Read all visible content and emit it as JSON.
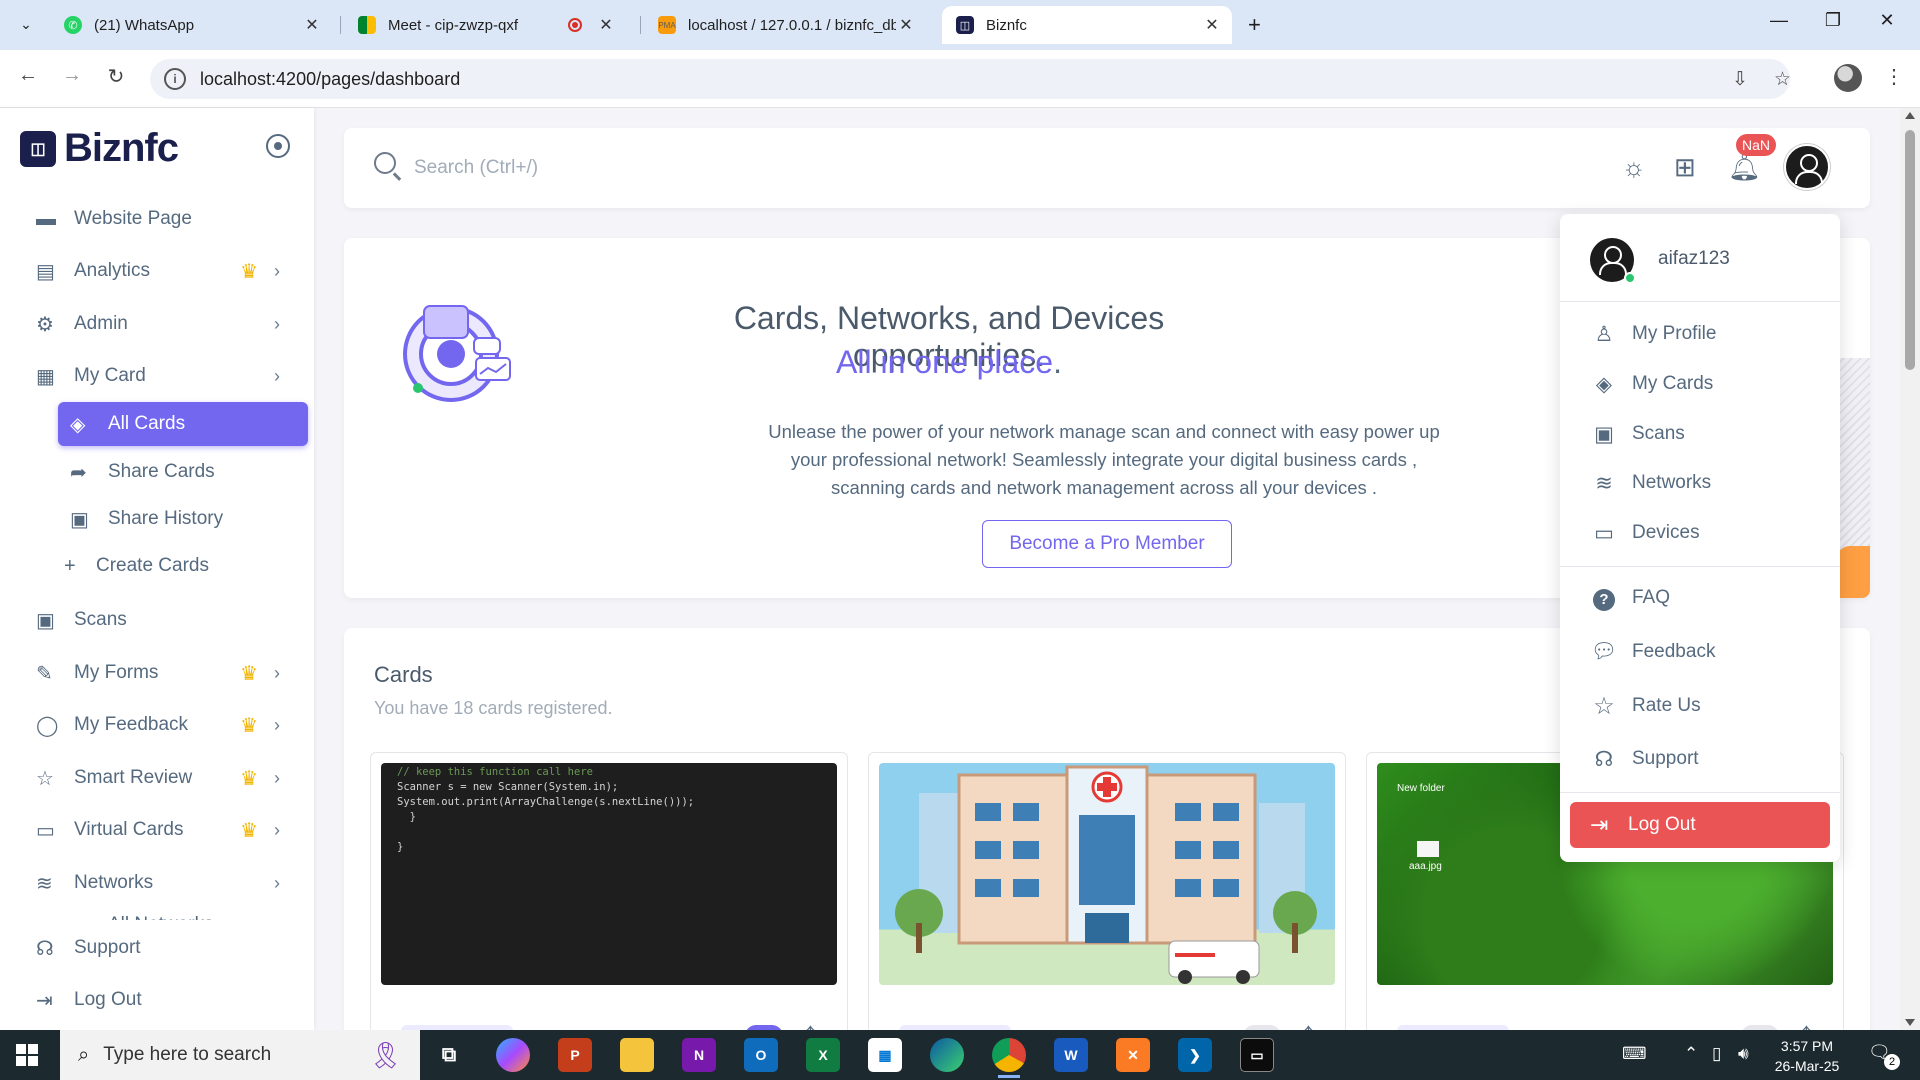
{
  "browser": {
    "tabs": [
      {
        "title": "(21) WhatsApp",
        "favicon": "whatsapp-icon"
      },
      {
        "title": "Meet - cip-zwzp-qxf",
        "favicon": "meet-icon"
      },
      {
        "title": "localhost / 127.0.0.1 / biznfc_db",
        "favicon": "phpmyadmin-icon"
      },
      {
        "title": "Biznfc",
        "favicon": "biznfc-icon",
        "active": true
      }
    ],
    "url": "localhost:4200/pages/dashboard"
  },
  "brand": {
    "name": "Biznfc"
  },
  "sidebar": {
    "items": [
      {
        "label": "Website Page",
        "icon": "briefcase-icon"
      },
      {
        "label": "Analytics",
        "icon": "chart-icon",
        "crown": true,
        "chevron": true
      },
      {
        "label": "Admin",
        "icon": "user-gear-icon",
        "chevron": true
      },
      {
        "label": "My Card",
        "icon": "card-icon",
        "chevron": true
      },
      {
        "label": "All Cards",
        "icon": "cards-icon",
        "active": true
      },
      {
        "label": "Share Cards",
        "icon": "share-icon"
      },
      {
        "label": "Share History",
        "icon": "qr-icon"
      },
      {
        "label": "Create Cards",
        "icon": "plus-icon"
      },
      {
        "label": "Scans",
        "icon": "qr-icon"
      },
      {
        "label": "My Forms",
        "icon": "form-icon",
        "crown": true,
        "chevron": true
      },
      {
        "label": "My Feedback",
        "icon": "chat-icon",
        "crown": true,
        "chevron": true
      },
      {
        "label": "Smart Review",
        "icon": "star-icon",
        "crown": true,
        "chevron": true
      },
      {
        "label": "Virtual Cards",
        "icon": "folder-icon",
        "crown": true,
        "chevron": true
      },
      {
        "label": "Networks",
        "icon": "wifi-icon",
        "chevron": true
      },
      {
        "label": "All Networks",
        "icon": "wifi-icon"
      }
    ],
    "footer": [
      {
        "label": "Support",
        "icon": "headset-icon"
      },
      {
        "label": "Log Out",
        "icon": "logout-icon"
      }
    ]
  },
  "topbar": {
    "search_placeholder": "Search (Ctrl+/)",
    "notification_badge": "NaN"
  },
  "hero": {
    "title_line1": "Cards, Networks, and Devices opportunities.",
    "title_line2_accent": "All in one place",
    "title_line2_end": ".",
    "text": "Unlease the power of your network manage scan and connect with easy power up your professional network! Seamlessly integrate your digital business cards , scanning cards and network management across all your devices .",
    "button": "Become a Pro Member"
  },
  "cards_section": {
    "title": "Cards",
    "subtitle": "You have 18 cards registered.",
    "cards": [
      {
        "image": "code-screenshot",
        "enabled": true
      },
      {
        "image": "hospital-illustration",
        "enabled": false
      },
      {
        "image": "green-trees-desktop",
        "enabled": false
      }
    ],
    "code_lines": [
      "// keep this function call here",
      "Scanner s = new Scanner(System.in);",
      "System.out.print(ArrayChallenge(s.nextLine()));",
      "}",
      "}"
    ],
    "desktop_labels": [
      "New folder",
      "aaa.jpg"
    ]
  },
  "dropdown": {
    "username": "aifaz123",
    "items": [
      {
        "label": "My Profile",
        "icon": "user-icon"
      },
      {
        "label": "My Cards",
        "icon": "cards-icon"
      },
      {
        "label": "Scans",
        "icon": "qr-icon"
      },
      {
        "label": "Networks",
        "icon": "wifi-icon"
      },
      {
        "label": "Devices",
        "icon": "monitor-icon"
      }
    ],
    "items2": [
      {
        "label": "FAQ",
        "icon": "help-icon"
      },
      {
        "label": "Feedback",
        "icon": "chat-icon"
      },
      {
        "label": "Rate Us",
        "icon": "star-icon"
      },
      {
        "label": "Support",
        "icon": "headset-icon"
      }
    ],
    "logout": "Log Out"
  },
  "taskbar": {
    "search_text": "Type here to search",
    "time": "3:57 PM",
    "date": "26-Mar-25",
    "notification_count": "2"
  },
  "colors": {
    "primary": "#7367f0",
    "danger": "#ea5455",
    "crown": "#f2b400",
    "success": "#28c76f"
  }
}
